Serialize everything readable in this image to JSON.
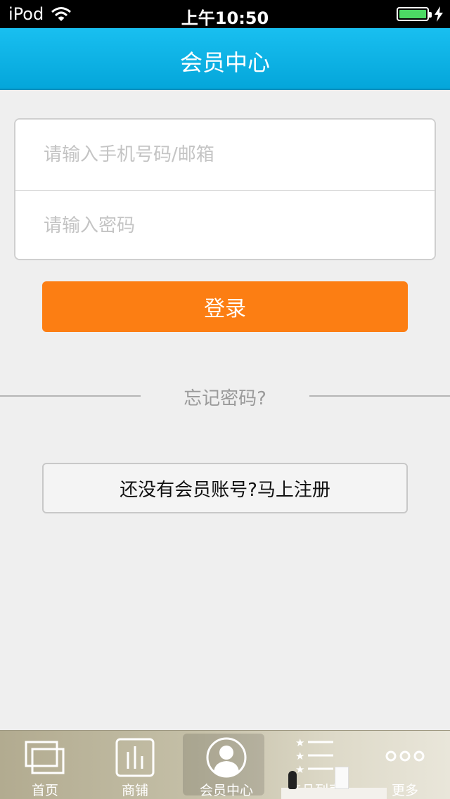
{
  "status_bar": {
    "carrier": "iPod",
    "time": "上午10:50"
  },
  "header": {
    "title": "会员中心"
  },
  "login_form": {
    "account_placeholder": "请输入手机号码/邮箱",
    "password_placeholder": "请输入密码",
    "account_value": "",
    "password_value": "",
    "login_label": "登录",
    "forgot_label": "忘记密码?",
    "register_label": "还没有会员账号?马上注册"
  },
  "tab_bar": {
    "active_index": 2,
    "items": [
      {
        "label": "首页",
        "icon": "home-windows-icon"
      },
      {
        "label": "商铺",
        "icon": "shop-bars-icon"
      },
      {
        "label": "会员中心",
        "icon": "member-avatar-icon"
      },
      {
        "label": "产品列表",
        "icon": "star-list-icon"
      },
      {
        "label": "更多",
        "icon": "more-dots-icon"
      }
    ]
  },
  "colors": {
    "nav_bar": "#09b4e6",
    "login_button": "#fc7e13",
    "background": "#efefef",
    "battery": "#4cd964"
  }
}
